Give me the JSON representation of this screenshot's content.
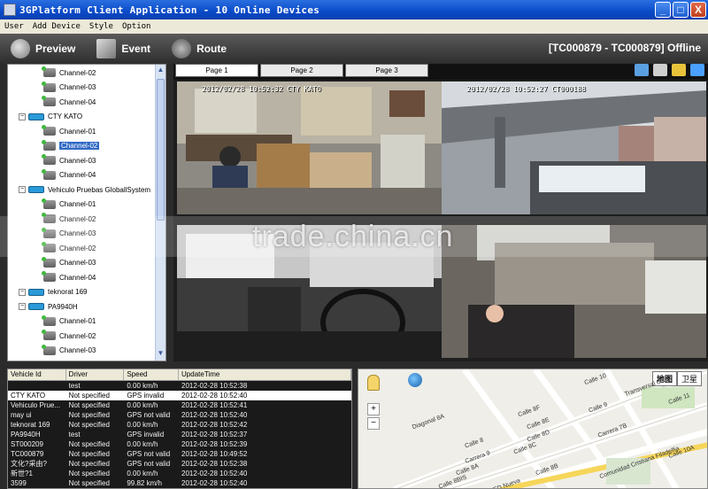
{
  "window": {
    "title": "3GPlatform Client Application - 10 Online Devices",
    "controls": [
      "_",
      "□",
      "X"
    ]
  },
  "menu": [
    "User",
    "Add Device",
    "Style",
    "Option"
  ],
  "toolbar": {
    "preview": "Preview",
    "event": "Event",
    "route": "Route",
    "device_status": "[TC000879 - TC000879] Offline"
  },
  "tree": {
    "rows": [
      {
        "kind": "channel",
        "label": "Channel-02"
      },
      {
        "kind": "channel",
        "label": "Channel-03"
      },
      {
        "kind": "channel",
        "label": "Channel-04"
      },
      {
        "kind": "device",
        "label": "CTY KATO"
      },
      {
        "kind": "channel",
        "label": "Channel-01"
      },
      {
        "kind": "channel",
        "label": "Channel-02",
        "selected": true
      },
      {
        "kind": "channel",
        "label": "Channel-03"
      },
      {
        "kind": "channel",
        "label": "Channel-04"
      },
      {
        "kind": "device",
        "label": "Vehiculo Pruebas GloballSystem"
      },
      {
        "kind": "channel",
        "label": "Channel-01"
      },
      {
        "kind": "channel",
        "label": "Channel-02"
      },
      {
        "kind": "channel",
        "label": "Channel-03"
      },
      {
        "kind": "channel",
        "label": "Channel-02"
      },
      {
        "kind": "channel",
        "label": "Channel-03"
      },
      {
        "kind": "channel",
        "label": "Channel-04"
      },
      {
        "kind": "device",
        "label": "teknorat 169"
      },
      {
        "kind": "device",
        "label": "PA9940H"
      },
      {
        "kind": "channel",
        "label": "Channel-01"
      },
      {
        "kind": "channel",
        "label": "Channel-02"
      },
      {
        "kind": "channel",
        "label": "Channel-03"
      }
    ]
  },
  "video": {
    "tabs": [
      "Page 1",
      "Page 2",
      "Page 3"
    ],
    "overlays": [
      "2012/02/28  10:52:32  CTY KATO",
      "2012/02/28  10:52:27  CT000188"
    ]
  },
  "table": {
    "headers": [
      "Vehicle Id",
      "Driver",
      "Speed",
      "UpdateTime"
    ],
    "rows": [
      [
        "",
        "test",
        "0.00 km/h",
        "2012-02-28 10:52:38"
      ],
      [
        "CTY KATO",
        "Not specified",
        "GPS invalid",
        "2012-02-28 10:52:40"
      ],
      [
        "Vehiculo Prue...",
        "Not specified",
        "0.00 km/h",
        "2012-02-28 10:52:41"
      ],
      [
        "may ui",
        "Not specified",
        "GPS not valid",
        "2012-02-28 10:52:40"
      ],
      [
        "teknorat 169",
        "Not specified",
        "0.00 km/h",
        "2012-02-28 10:52:42"
      ],
      [
        "PA9940H",
        "test",
        "GPS invalid",
        "2012-02-28 10:52:37"
      ],
      [
        "ST000209",
        "Not specified",
        "0.00 km/h",
        "2012-02-28 10:52:39"
      ],
      [
        "TC000879",
        "Not specified",
        "GPS not valid",
        "2012-02-28 10:49:52"
      ],
      [
        "文化?采由?",
        "Not specified",
        "GPS not valid",
        "2012-02-28 10:52:38"
      ],
      [
        "新世?1",
        "Not specified",
        "0.00 km/h",
        "2012-02-28 10:52:40"
      ],
      [
        "3599",
        "Not specified",
        "99.82 km/h",
        "2012-02-28 10:52:40"
      ]
    ]
  },
  "map": {
    "buttons": [
      "地图",
      "卫星"
    ],
    "zoom": [
      "+",
      "−"
    ],
    "labels": [
      "Calle 10",
      "Transversal 6",
      "Calle 11",
      "Diagonal 8A",
      "Calle 8F",
      "Calle 8E",
      "Calle 8D",
      "Calle 8C",
      "Carrera 9",
      "Carrera 7B",
      "Calle 8BIS",
      "Calle 8A",
      "Calle 8B",
      "Calle 8",
      "Calle 10A",
      "Calle 9",
      "Comunidad Cristiana Filadelfia",
      "IED Nueva"
    ]
  },
  "watermark": "trade.china.cn"
}
